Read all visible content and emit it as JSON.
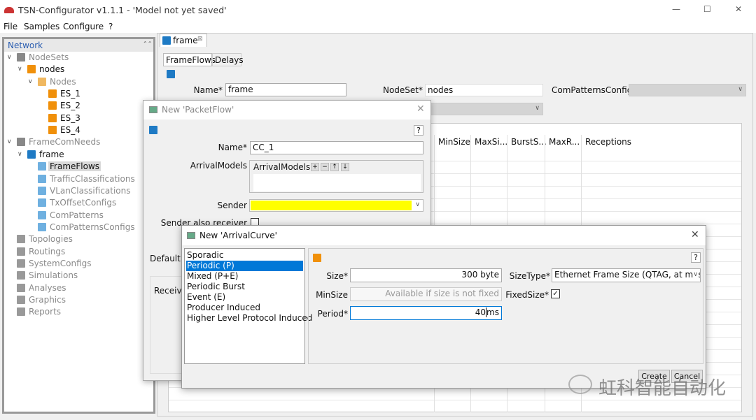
{
  "window": {
    "title": "TSN-Configurator v1.1.1 - 'Model not yet saved'",
    "minimize": "—",
    "maximize": "☐",
    "close": "✕"
  },
  "menu": [
    "File",
    "Samples",
    "Configure",
    "?"
  ],
  "sidebar": {
    "title": "Network",
    "collapse": "⌃⌃",
    "items": [
      {
        "label": "NodeSets",
        "icon": "nodesets-icon"
      },
      {
        "label": "nodes",
        "icon": "nodes-icon"
      },
      {
        "label": "Nodes",
        "icon": "node-group-icon"
      },
      {
        "label": "ES_1",
        "icon": "node-icon"
      },
      {
        "label": "ES_2",
        "icon": "node-icon"
      },
      {
        "label": "ES_3",
        "icon": "node-icon"
      },
      {
        "label": "ES_4",
        "icon": "node-icon"
      },
      {
        "label": "FrameComNeeds",
        "icon": "framecomneeds-icon"
      },
      {
        "label": "frame",
        "icon": "frame-icon"
      },
      {
        "label": "FrameFlows",
        "icon": "frameflows-icon"
      },
      {
        "label": "TrafficClassifications",
        "icon": "traffic-icon"
      },
      {
        "label": "VLanClassifications",
        "icon": "vlan-icon"
      },
      {
        "label": "TxOffsetConfigs",
        "icon": "txoffset-icon"
      },
      {
        "label": "ComPatterns",
        "icon": "compatterns-icon"
      },
      {
        "label": "ComPatternsConfigs",
        "icon": "compatternsconfigs-icon"
      },
      {
        "label": "Topologies",
        "icon": "topologies-icon"
      },
      {
        "label": "Routings",
        "icon": "routings-icon"
      },
      {
        "label": "SystemConfigs",
        "icon": "systemconfigs-icon"
      },
      {
        "label": "Simulations",
        "icon": "simulations-icon"
      },
      {
        "label": "Analyses",
        "icon": "analyses-icon"
      },
      {
        "label": "Graphics",
        "icon": "graphics-icon"
      },
      {
        "label": "Reports",
        "icon": "reports-icon"
      }
    ],
    "selected": "FrameFlows"
  },
  "editor": {
    "tab": "frame",
    "tab_close": "⊠",
    "subtabs": [
      "FrameFlows",
      "Delays"
    ],
    "name_label": "Name*",
    "name_value": "frame",
    "nodeset_label": "NodeSet*",
    "nodeset_value": "nodes",
    "compatterns_label": "ComPatternsConfig",
    "columns": [
      "MinSize",
      "MaxSi...",
      "BurstS...",
      "MaxR...",
      "Receptions"
    ]
  },
  "packetflow": {
    "title": "New 'PacketFlow'",
    "help": "?",
    "name_label": "Name*",
    "name_value": "CC_1",
    "arrival_label": "ArrivalModels",
    "arrival_header": "ArrivalModels",
    "arrival_buttons": [
      "+",
      "−",
      "↑",
      "↓"
    ],
    "sender_label": "Sender",
    "sender_value": "",
    "sender_color": "#ffff00",
    "sender_receiver_label": "Sender also receiver",
    "sender_receiver_checked": false,
    "default_label": "Default l",
    "receive_label": "Receive"
  },
  "arrivalcurve": {
    "title": "New 'ArrivalCurve'",
    "close": "✕",
    "help": "?",
    "types": [
      "Sporadic",
      "Periodic (P)",
      "Mixed (P+E)",
      "Periodic Burst",
      "Event (E)",
      "Producer Induced",
      "Higher Level Protocol Induced"
    ],
    "selected_type": "Periodic (P)",
    "size_label": "Size*",
    "size_value": "300 byte",
    "minsize_label": "MinSize",
    "minsize_placeholder": "Available if size is not fixed",
    "period_label": "Period*",
    "period_value": "40",
    "period_unit": "ms",
    "sizetype_label": "SizeType*",
    "sizetype_value": "Ethernet Frame Size (QTAG, at mos",
    "fixedsize_label": "FixedSize*",
    "fixedsize_checked": true,
    "create": "Create",
    "cancel": "Cancel"
  },
  "watermark": "虹科智能自动化",
  "colors": {
    "selection": "#0078d7",
    "accent_orange": "#f0900a",
    "icon_blue": "#1e7ac4"
  }
}
